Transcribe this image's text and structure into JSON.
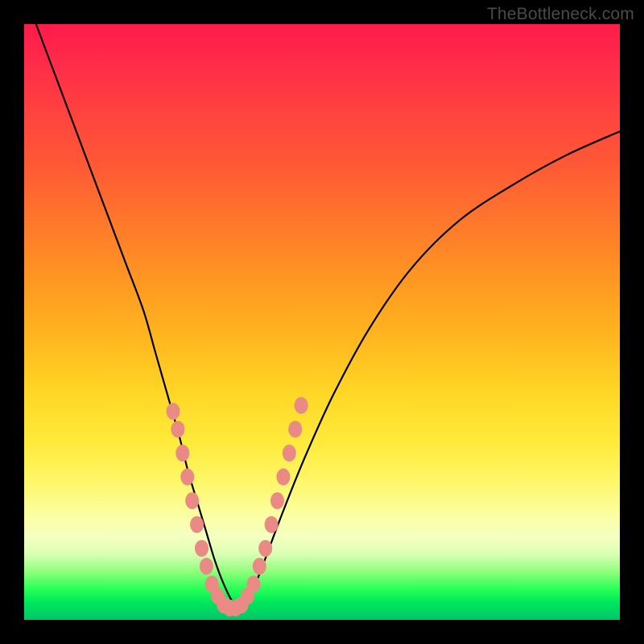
{
  "watermark": "TheBottleneck.com",
  "colors": {
    "frame": "#000000",
    "curve_stroke": "#000000",
    "marker_fill": "#e98b84",
    "marker_stroke": "#e98b84",
    "gradient_stops": [
      "#ff1b4a",
      "#ff4040",
      "#ff7a2a",
      "#ffbb1f",
      "#ffea3a",
      "#f5ffc0",
      "#22ff55",
      "#00c66a"
    ]
  },
  "chart_data": {
    "type": "line",
    "title": "",
    "xlabel": "",
    "ylabel": "",
    "xlim": [
      0,
      100
    ],
    "ylim": [
      0,
      100
    ],
    "note": "Axes are unlabeled in the source image. x is left→right, y is bottom→top (0 = bottom of plot). Values are pixel-fraction estimates read from the image, expressed on a 0–100 scale.",
    "series": [
      {
        "name": "bottleneck-curve",
        "x": [
          2,
          5,
          8,
          11,
          14,
          17,
          20,
          22,
          24,
          26,
          27.5,
          29,
          30.5,
          32,
          33.5,
          35,
          36.5,
          38,
          40,
          43,
          47,
          52,
          58,
          65,
          73,
          82,
          91,
          100
        ],
        "y": [
          100,
          92,
          84,
          76,
          68,
          60,
          52,
          45,
          38,
          31,
          25,
          20,
          15,
          10,
          6,
          3,
          1.5,
          4,
          9,
          17,
          27,
          38,
          49,
          59,
          67,
          73,
          78,
          82
        ]
      }
    ],
    "markers": {
      "name": "highlight-dots",
      "note": "Salmon-colored dots clustered near the curve's minimum on both flanks; positions estimated.",
      "points": [
        {
          "x": 25.0,
          "y": 35
        },
        {
          "x": 25.8,
          "y": 32
        },
        {
          "x": 26.6,
          "y": 28
        },
        {
          "x": 27.4,
          "y": 24
        },
        {
          "x": 28.2,
          "y": 20
        },
        {
          "x": 29.0,
          "y": 16
        },
        {
          "x": 29.8,
          "y": 12
        },
        {
          "x": 30.6,
          "y": 9
        },
        {
          "x": 31.5,
          "y": 6
        },
        {
          "x": 32.5,
          "y": 4
        },
        {
          "x": 33.5,
          "y": 2.5
        },
        {
          "x": 34.5,
          "y": 2
        },
        {
          "x": 35.5,
          "y": 2
        },
        {
          "x": 36.5,
          "y": 2.5
        },
        {
          "x": 37.5,
          "y": 4
        },
        {
          "x": 38.5,
          "y": 6
        },
        {
          "x": 39.5,
          "y": 9
        },
        {
          "x": 40.5,
          "y": 12
        },
        {
          "x": 41.5,
          "y": 16
        },
        {
          "x": 42.5,
          "y": 20
        },
        {
          "x": 43.5,
          "y": 24
        },
        {
          "x": 44.5,
          "y": 28
        },
        {
          "x": 45.5,
          "y": 32
        },
        {
          "x": 46.5,
          "y": 36
        }
      ]
    }
  }
}
